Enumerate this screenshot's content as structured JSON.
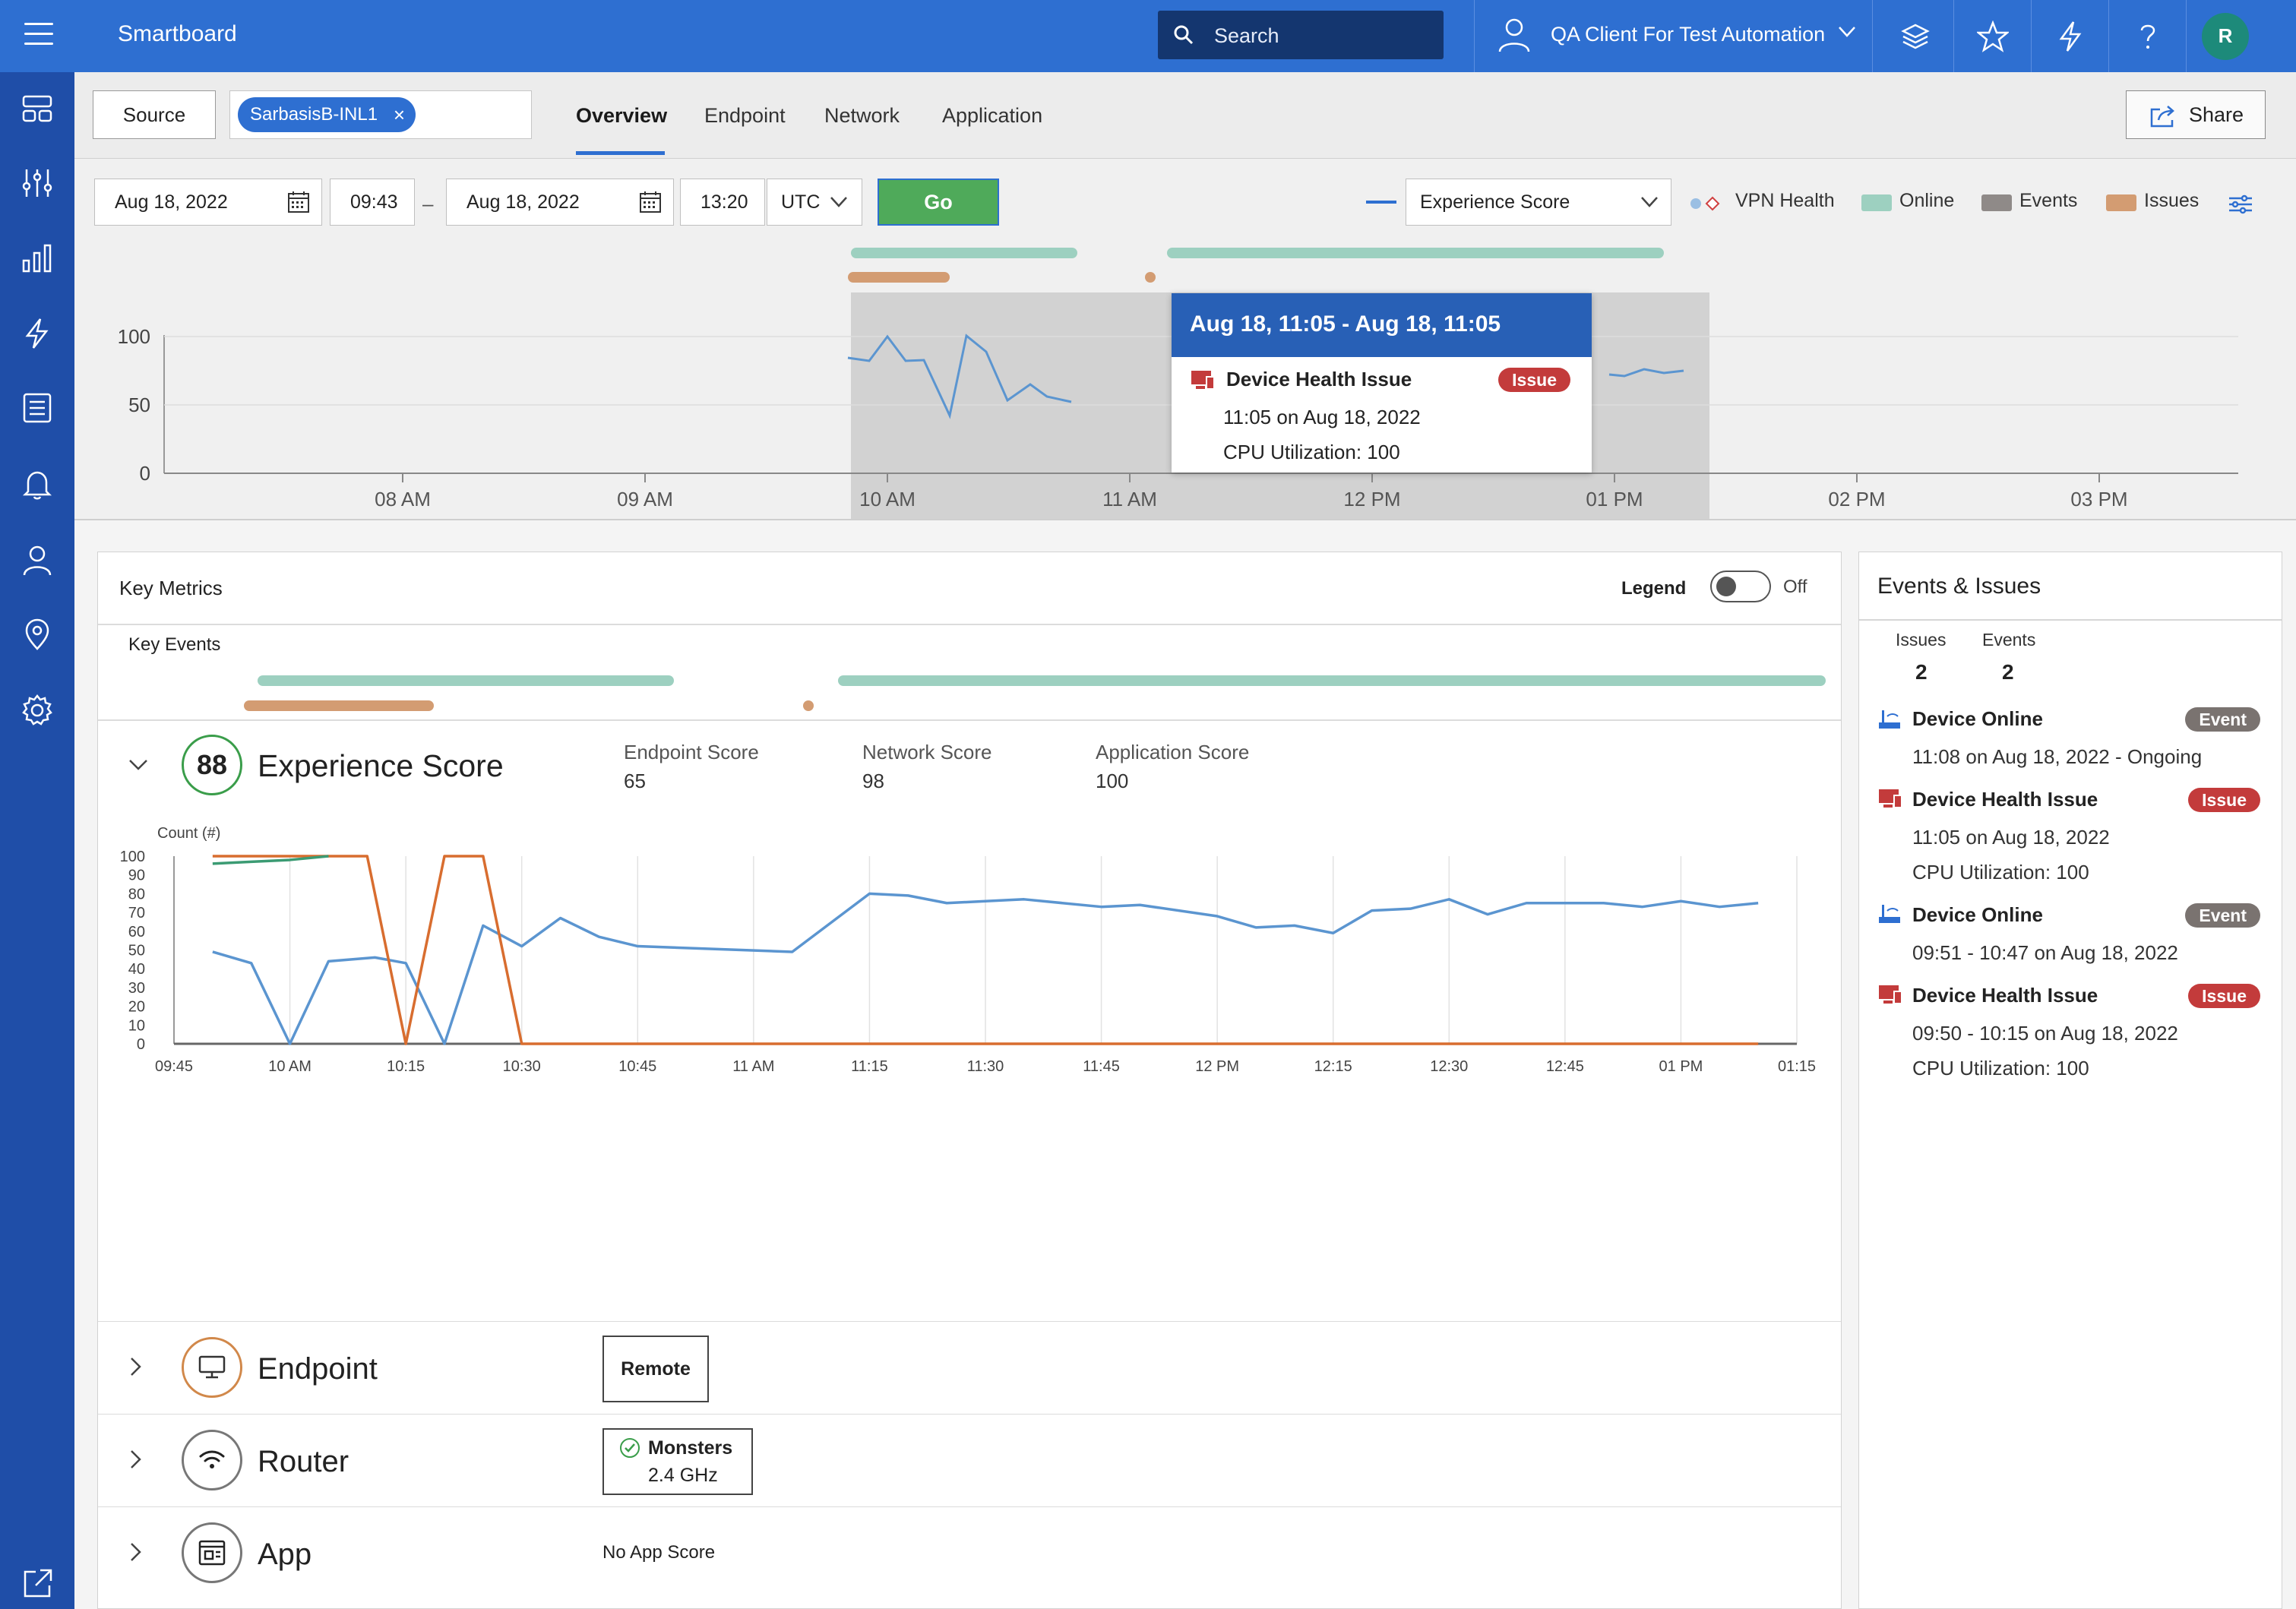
{
  "header": {
    "title": "Smartboard",
    "search_placeholder": "Search",
    "client_name": "QA Client For Test Automation",
    "avatar_initial": "R",
    "brand_color": "#2e6fd1"
  },
  "tabbar": {
    "source_label": "Source",
    "source_chip": "SarbasisB-INL1",
    "tabs": [
      {
        "label": "Overview",
        "active": true
      },
      {
        "label": "Endpoint",
        "active": false
      },
      {
        "label": "Network",
        "active": false
      },
      {
        "label": "Application",
        "active": false
      }
    ],
    "share_label": "Share"
  },
  "filters": {
    "start_date": "Aug 18, 2022",
    "start_time": "09:43",
    "separator": "–",
    "end_date": "Aug 18, 2022",
    "end_time": "13:20",
    "timezone": "UTC",
    "go_label": "Go",
    "metric_select": "Experience Score",
    "legend": [
      {
        "label": "VPN Health"
      },
      {
        "label": "Online",
        "color": "#9dd0c0"
      },
      {
        "label": "Events",
        "color": "#8f8a88"
      },
      {
        "label": "Issues",
        "color": "#d39c72"
      }
    ]
  },
  "overview_chart": {
    "y_ticks": [
      "100",
      "50",
      "0"
    ],
    "x_ticks": [
      "08 AM",
      "09 AM",
      "10 AM",
      "11 AM",
      "12 PM",
      "01 PM",
      "02 PM",
      "03 PM"
    ]
  },
  "tooltip": {
    "title": "Aug 18, 11:05 - Aug 18, 11:05",
    "event_title": "Device Health Issue",
    "badge": "Issue",
    "time": "11:05 on Aug 18, 2022",
    "detail": "CPU Utilization: 100"
  },
  "key_metrics": {
    "title": "Key Metrics",
    "legend_label": "Legend",
    "legend_state": "Off",
    "key_events_label": "Key Events",
    "experience": {
      "score": "88",
      "title": "Experience Score",
      "endpoint_label": "Endpoint Score",
      "endpoint_value": "65",
      "network_label": "Network Score",
      "network_value": "98",
      "application_label": "Application Score",
      "application_value": "100"
    },
    "rows": {
      "endpoint": {
        "label": "Endpoint",
        "box": "Remote"
      },
      "router": {
        "label": "Router",
        "box_line1": "Monsters",
        "box_line2": "2.4 GHz"
      },
      "app": {
        "label": "App",
        "note": "No App Score"
      }
    }
  },
  "chart_data": {
    "type": "line",
    "title": "",
    "ylabel": "Count (#)",
    "ylim": [
      0,
      100
    ],
    "y_ticks": [
      "100",
      "90",
      "80",
      "70",
      "60",
      "50",
      "40",
      "30",
      "20",
      "10",
      "0"
    ],
    "x_ticks": [
      "09:45",
      "10 AM",
      "10:15",
      "10:30",
      "10:45",
      "11 AM",
      "11:15",
      "11:30",
      "11:45",
      "12 PM",
      "12:15",
      "12:30",
      "12:45",
      "01 PM",
      "01:15"
    ],
    "series": [
      {
        "color": "#5b95d0",
        "points": [
          [
            "09:50",
            49
          ],
          [
            "09:55",
            43
          ],
          [
            "10:00",
            0
          ],
          [
            "10:05",
            44
          ],
          [
            "10:11",
            46
          ],
          [
            "10:15",
            43
          ],
          [
            "10:20",
            0
          ],
          [
            "10:25",
            63
          ],
          [
            "10:30",
            52
          ],
          [
            "10:35",
            67
          ],
          [
            "10:40",
            57
          ],
          [
            "10:45",
            52
          ],
          [
            "11:05",
            49
          ],
          [
            "11:15",
            80
          ],
          [
            "11:20",
            79
          ],
          [
            "11:25",
            75
          ],
          [
            "11:30",
            76
          ],
          [
            "11:35",
            77
          ],
          [
            "11:45",
            73
          ],
          [
            "11:50",
            74
          ],
          [
            "12:00",
            68
          ],
          [
            "12:05",
            62
          ],
          [
            "12:10",
            63
          ],
          [
            "12:15",
            59
          ],
          [
            "12:20",
            71
          ],
          [
            "12:25",
            72
          ],
          [
            "12:30",
            77
          ],
          [
            "12:35",
            69
          ],
          [
            "12:40",
            75
          ],
          [
            "12:45",
            75
          ],
          [
            "12:50",
            75
          ],
          [
            "12:55",
            73
          ],
          [
            "13:00",
            76
          ],
          [
            "13:05",
            73
          ],
          [
            "13:10",
            75
          ]
        ]
      },
      {
        "color": "#d86d2f",
        "points": [
          [
            "09:50",
            100
          ],
          [
            "10:10",
            100
          ],
          [
            "10:15",
            0
          ],
          [
            "10:20",
            100
          ],
          [
            "10:25",
            100
          ],
          [
            "10:30",
            0
          ],
          [
            "13:10",
            0
          ]
        ]
      },
      {
        "color": "#3b9b73",
        "points": [
          [
            "09:50",
            96
          ],
          [
            "09:55",
            97
          ],
          [
            "10:00",
            98
          ],
          [
            "10:05",
            100
          ]
        ]
      }
    ]
  },
  "events_panel": {
    "title": "Events & Issues",
    "issues_label": "Issues",
    "issues_count": "2",
    "events_label": "Events",
    "events_count": "2",
    "items": [
      {
        "title": "Device Online",
        "badge": "Event",
        "line1": "11:08 on Aug 18, 2022 - Ongoing",
        "line2": ""
      },
      {
        "title": "Device Health Issue",
        "badge": "Issue",
        "line1": "11:05 on Aug 18, 2022",
        "line2": "CPU Utilization: 100"
      },
      {
        "title": "Device Online",
        "badge": "Event",
        "line1": "09:51 - 10:47 on Aug 18, 2022",
        "line2": ""
      },
      {
        "title": "Device Health Issue",
        "badge": "Issue",
        "line1": "09:50 - 10:15 on Aug 18, 2022",
        "line2": "CPU Utilization: 100"
      }
    ]
  }
}
